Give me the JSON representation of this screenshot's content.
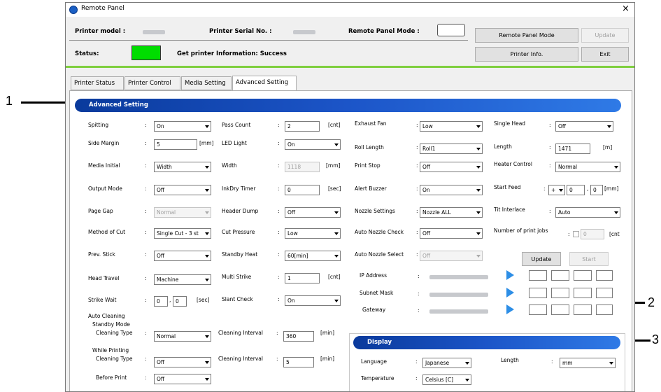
{
  "window": {
    "title": "Remote Panel",
    "close_glyph": "×"
  },
  "header": {
    "printer_model_label": "Printer model :",
    "printer_serial_label": "Printer Serial No. :",
    "remote_panel_mode_label": "Remote Panel Mode :",
    "status_label": "Status:",
    "status_message": "Get printer Information: Success",
    "status_color": "#00dd00",
    "buttons": {
      "remote_panel_mode": "Remote Panel Mode",
      "update": "Update",
      "printer_info": "Printer Info.",
      "exit": "Exit"
    }
  },
  "tabs": [
    "Printer Status",
    "Printer Control",
    "Media Setting",
    "Advanced Setting"
  ],
  "advanced": {
    "title": "Advanced Setting",
    "col1": {
      "spitting": {
        "label": "Spitting",
        "value": "On"
      },
      "side_margin": {
        "label": "Side Margin",
        "value": "5",
        "unit": "[mm]"
      },
      "media_initial": {
        "label": "Media Initial",
        "value": "Width"
      },
      "output_mode": {
        "label": "Output Mode",
        "value": "Off"
      },
      "page_gap": {
        "label": "Page Gap",
        "value": "Normal"
      },
      "method_of_cut": {
        "label": "Method of Cut",
        "value": "Single Cut - 3 st"
      },
      "prev_stick": {
        "label": "Prev. Stick",
        "value": "Off"
      },
      "head_travel": {
        "label": "Head Travel",
        "value": "Machine"
      },
      "strike_wait": {
        "label": "Strike Wait",
        "value1": "0",
        "value2": "0",
        "unit": "[sec]"
      }
    },
    "col2": {
      "pass_count": {
        "label": "Pass Count",
        "value": "2",
        "unit": "[cnt]"
      },
      "led_light": {
        "label": "LED Light",
        "value": "On"
      },
      "width": {
        "label": "Width",
        "value": "1118",
        "unit": "[mm]"
      },
      "inkdry_timer": {
        "label": "InkDry Timer",
        "value": "0",
        "unit": "[sec]"
      },
      "header_dump": {
        "label": "Header Dump",
        "value": "Off"
      },
      "cut_pressure": {
        "label": "Cut Pressure",
        "value": "Low"
      },
      "standby_heat": {
        "label": "Standby Heat",
        "value": "60[min]"
      },
      "multi_strike": {
        "label": "Multi Strike",
        "value": "1",
        "unit": "[cnt]"
      },
      "slant_check": {
        "label": "Slant Check",
        "value": "On"
      }
    },
    "col3": {
      "exhaust_fan": {
        "label": "Exhaust Fan",
        "value": "Low"
      },
      "roll_length": {
        "label": "Roll Length",
        "value": "Roll1"
      },
      "print_stop": {
        "label": "Print Stop",
        "value": "Off"
      },
      "alert_buzzer": {
        "label": "Alert Buzzer",
        "value": "On"
      },
      "nozzle_settings": {
        "label": "Nozzle Settings",
        "value": "Nozzle ALL"
      },
      "auto_nozzle_check": {
        "label": "Auto Nozzle Check",
        "value": "Off"
      },
      "auto_nozzle_select": {
        "label": "Auto Nozzle Select",
        "value": "Off"
      }
    },
    "col4": {
      "single_head": {
        "label": "Single Head",
        "value": "Off"
      },
      "length": {
        "label": "Length",
        "value": "1471",
        "unit": "[m]"
      },
      "heater_control": {
        "label": "Heater Control",
        "value": "Normal"
      },
      "start_feed": {
        "label": "Start Feed",
        "sign": "+",
        "value1": "0",
        "value2": "0",
        "unit": "[mm]"
      },
      "tit_interlace": {
        "label": "Tit Interlace",
        "value": "Auto"
      },
      "number_of_print_jobs": {
        "label": "Number of print jobs",
        "value": "0",
        "unit": "[cnt"
      }
    },
    "network": {
      "update": "Update",
      "start": "Start",
      "ip_address": "IP Address",
      "subnet_mask": "Subnet Mask",
      "gateway": "Gateway"
    },
    "auto_cleaning": {
      "title": "Auto Cleaning",
      "standby_mode": "Standby Mode",
      "standby_cleaning_type": {
        "label": "Cleaning Type",
        "value": "Normal"
      },
      "standby_cleaning_interval": {
        "label": "Cleaning Interval",
        "value": "360",
        "unit": "[min]"
      },
      "while_printing": "While Printing",
      "printing_cleaning_type": {
        "label": "Cleaning Type",
        "value": "Off"
      },
      "printing_cleaning_interval": {
        "label": "Cleaning Interval",
        "value": "5",
        "unit": "[min]"
      },
      "before_print": {
        "label": "Before Print",
        "value": "Off"
      }
    }
  },
  "display": {
    "title": "Display",
    "language": {
      "label": "Language",
      "value": "Japanese"
    },
    "temperature": {
      "label": "Temperature",
      "value": "Celsius [C]"
    },
    "length": {
      "label": "Length",
      "value": "mm"
    }
  },
  "callouts": [
    "1",
    "2",
    "3"
  ]
}
